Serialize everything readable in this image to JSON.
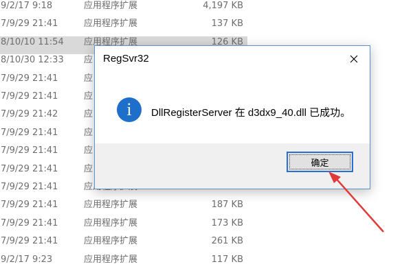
{
  "file_list": [
    {
      "date": "9/2/17 9:18",
      "type": "应用程序扩展",
      "size": "4,197 KB",
      "selected": false
    },
    {
      "date": "7/9/29 21:41",
      "type": "应用程序扩展",
      "size": "137 KB",
      "selected": false
    },
    {
      "date": "8/10/10 11:54",
      "type": "应用程序扩展",
      "size": "126 KB",
      "selected": true
    },
    {
      "date": "8/10/30 12:33",
      "type": "应",
      "size": "",
      "selected": false
    },
    {
      "date": "7/9/29 21:41",
      "type": "应",
      "size": "",
      "selected": false
    },
    {
      "date": "7/9/29 21:41",
      "type": "应",
      "size": "",
      "selected": false
    },
    {
      "date": "7/9/29 21:42",
      "type": "应",
      "size": "",
      "selected": false
    },
    {
      "date": "7/9/29 21:41",
      "type": "应",
      "size": "",
      "selected": false
    },
    {
      "date": "7/9/29 21:41",
      "type": "应",
      "size": "",
      "selected": false
    },
    {
      "date": "7/9/29 21:41",
      "type": "应",
      "size": "",
      "selected": false
    },
    {
      "date": "7/9/29 21:41",
      "type": "应用程序扩展",
      "size": "",
      "selected": false
    },
    {
      "date": "7/9/29 21:41",
      "type": "应用程序扩展",
      "size": "187 KB",
      "selected": false
    },
    {
      "date": "7/9/29 21:41",
      "type": "应用程序扩展",
      "size": "173 KB",
      "selected": false
    },
    {
      "date": "7/9/29 21:41",
      "type": "应用程序扩展",
      "size": "261 KB",
      "selected": false
    },
    {
      "date": "9/2/17 9:23",
      "type": "应用程序扩展",
      "size": "117 KB",
      "selected": false
    }
  ],
  "dialog": {
    "title": "RegSvr32",
    "close_icon": "close-icon",
    "icon": "info-icon",
    "icon_glyph": "i",
    "message": "DllRegisterServer 在 d3dx9_40.dll 已成功。",
    "ok_label": "确定"
  },
  "colors": {
    "accent": "#2a6fd2",
    "info_icon": "#1e6fc9",
    "arrow": "#e03a3a",
    "selected_row": "#d9d9d9"
  }
}
